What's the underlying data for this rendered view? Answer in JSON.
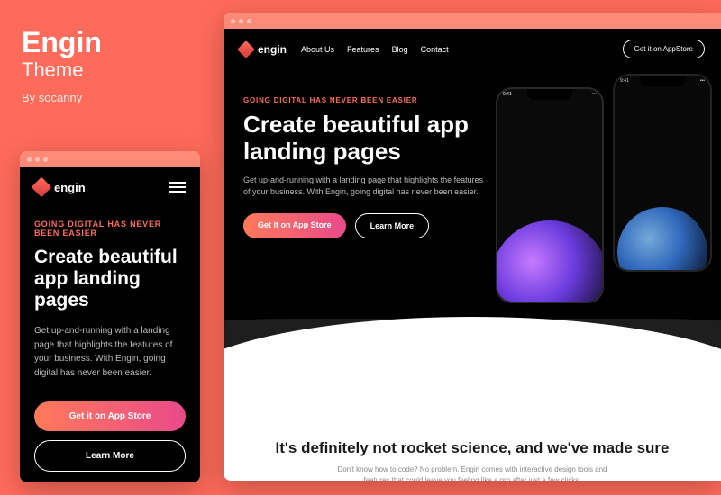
{
  "theme": {
    "name": "Engin",
    "subtitle": "Theme",
    "byline": "By socanny"
  },
  "brand": "engin",
  "nav": {
    "items": [
      "About Us",
      "Features",
      "Blog",
      "Contact"
    ],
    "cta": "Get it on AppStore"
  },
  "hero": {
    "eyebrow": "GOING DIGITAL HAS NEVER BEEN EASIER",
    "headline": "Create beautiful app landing pages",
    "description": "Get up-and-running with a landing page that highlights the features of your business. With Engin, going digital has never been easier.",
    "primary_cta": "Get it on App Store",
    "secondary_cta": "Learn More"
  },
  "phone": {
    "time": "9:41"
  },
  "below_fold": {
    "title": "It's definitely not rocket science, and we've made sure",
    "text": "Don't know how to code? No problem. Engin comes with interactive design tools and features that could leave you feeling like a pro after just a few clicks."
  }
}
